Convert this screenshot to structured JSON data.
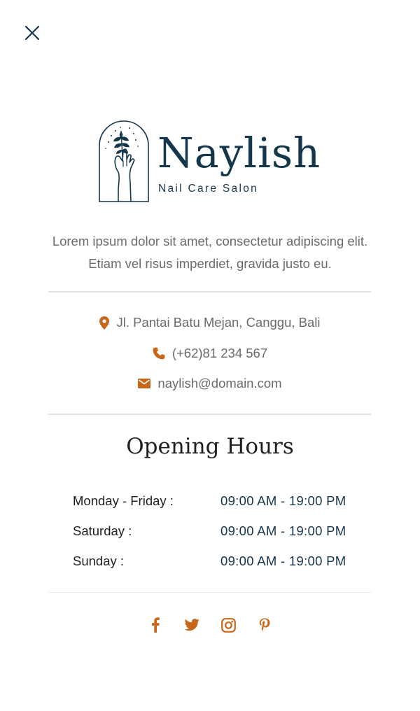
{
  "brand": {
    "name": "Naylish",
    "tagline": "Nail Care Salon"
  },
  "description": {
    "line1": "Lorem ipsum dolor sit amet, consectetur adipiscing elit.",
    "line2": "Etiam vel risus imperdiet, gravida justo eu."
  },
  "contact": {
    "address": "Jl. Pantai Batu Mejan, Canggu, Bali",
    "phone": "(+62)81 234 567",
    "email": "naylish@domain.com"
  },
  "hours": {
    "title": "Opening Hours",
    "rows": [
      {
        "day": "Monday - Friday :",
        "time": "09:00 AM - 19:00 PM"
      },
      {
        "day": "Saturday :",
        "time": "09:00 AM - 19:00 PM"
      },
      {
        "day": "Sunday :",
        "time": "09:00 AM - 19:00 PM"
      }
    ]
  },
  "icons": {
    "close": "close-icon",
    "address": "map-pin-icon",
    "phone": "phone-icon",
    "email": "envelope-icon",
    "socials": [
      "facebook-icon",
      "twitter-icon",
      "instagram-icon",
      "pinterest-icon"
    ]
  },
  "colors": {
    "brand_navy": "#15374b",
    "accent_orange": "#c8671a",
    "text_gray": "#6b6b6b"
  }
}
